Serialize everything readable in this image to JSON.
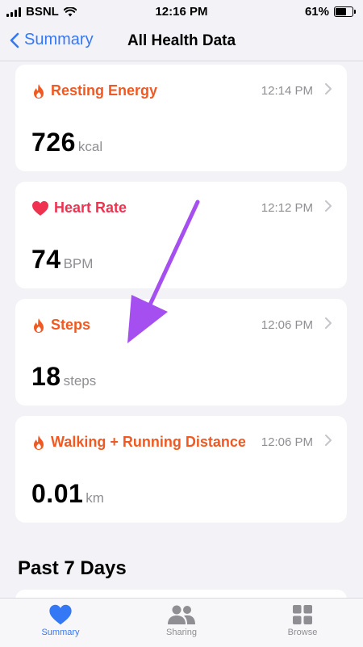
{
  "status_bar": {
    "carrier": "BSNL",
    "time": "12:16 PM",
    "battery": "61%"
  },
  "nav": {
    "back_label": "Summary",
    "title": "All Health Data"
  },
  "cards": [
    {
      "title": "Resting Energy",
      "time": "12:14 PM",
      "value": "726",
      "unit": "kcal",
      "icon": "flame-icon",
      "color": "#f05a22"
    },
    {
      "title": "Heart Rate",
      "time": "12:12 PM",
      "value": "74",
      "unit": "BPM",
      "icon": "heart-icon",
      "color": "#ee3250"
    },
    {
      "title": "Steps",
      "time": "12:06 PM",
      "value": "18",
      "unit": "steps",
      "icon": "flame-icon",
      "color": "#f05a22"
    },
    {
      "title": "Walking + Running Distance",
      "time": "12:06 PM",
      "value": "0.01",
      "unit": "km",
      "icon": "flame-icon",
      "color": "#f05a22"
    }
  ],
  "section": {
    "heading": "Past 7 Days"
  },
  "tabs": [
    {
      "label": "Summary",
      "icon": "heart-icon",
      "active": true
    },
    {
      "label": "Sharing",
      "icon": "people-icon",
      "active": false
    },
    {
      "label": "Browse",
      "icon": "grid-icon",
      "active": false
    }
  ],
  "colors": {
    "accent": "#3478f6",
    "annotation_arrow": "#a64ff0"
  }
}
